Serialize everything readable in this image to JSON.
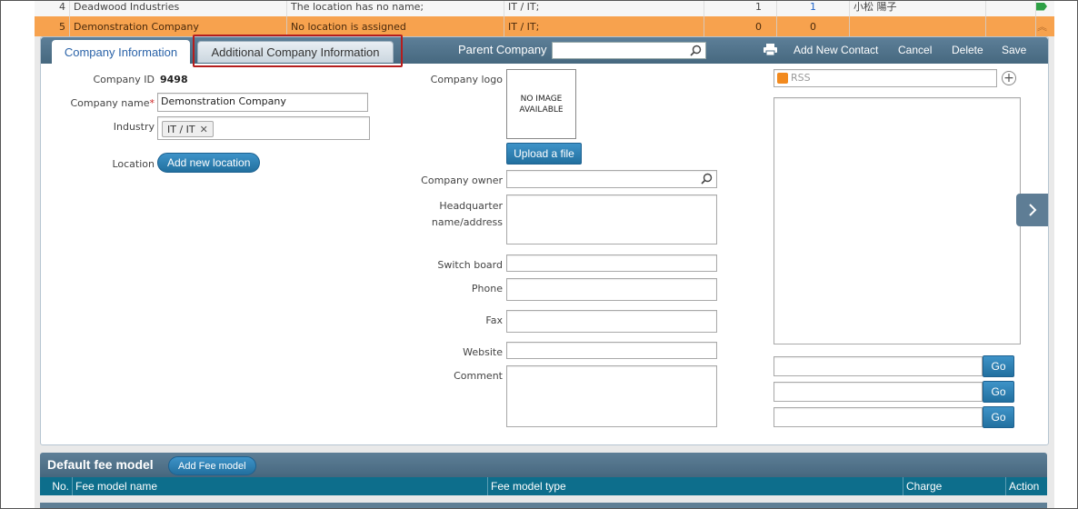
{
  "grid": {
    "rows": [
      {
        "num": "4",
        "name": "Deadwood Industries",
        "location": "The location has no name;",
        "industry": "IT / IT;",
        "c1": "1",
        "c2": "1",
        "contact": "小松 陽子"
      },
      {
        "num": "5",
        "name": "Demonstration Company",
        "location": "No location is assigned",
        "industry": "IT / IT;",
        "c1": "0",
        "c2": "0",
        "contact": ""
      }
    ]
  },
  "tabs": {
    "company_information": "Company Information",
    "additional_company_information": "Additional Company Information"
  },
  "toolbar": {
    "parent_company_label": "Parent Company",
    "parent_company_value": "",
    "add_new_contact": "Add New Contact",
    "cancel": "Cancel",
    "delete": "Delete",
    "save": "Save"
  },
  "form": {
    "company_id_label": "Company ID",
    "company_id_value": "9498",
    "company_name_label": "Company name",
    "required_mark": "*",
    "company_name_value": "Demonstration Company",
    "industry_label": "Industry",
    "industry_tag": "IT / IT",
    "tag_remove_glyph": "✕",
    "location_label": "Location",
    "add_new_location": "Add new location",
    "company_logo_label": "Company logo",
    "no_image_line1": "NO IMAGE",
    "no_image_line2": "AVAILABLE",
    "upload_file": "Upload a file",
    "company_owner_label": "Company owner",
    "company_owner_value": "",
    "headquarter_label_line1": "Headquarter",
    "headquarter_label_line2": "name/address",
    "headquarter_value": "",
    "switch_board_label": "Switch board",
    "switch_board_value": "",
    "phone_label": "Phone",
    "phone_value": "",
    "fax_label": "Fax",
    "fax_value": "",
    "website_label": "Website",
    "website_value": "",
    "comment_label": "Comment",
    "comment_value": ""
  },
  "right_panel": {
    "rss_placeholder": "RSS",
    "go_buttons": [
      "Go",
      "Go",
      "Go"
    ],
    "go_inputs": [
      "",
      "",
      ""
    ]
  },
  "fee_model": {
    "title": "Default fee model",
    "add_button": "Add Fee model",
    "columns": [
      "No.",
      "Fee model name",
      "Fee model type",
      "Charge",
      "Action"
    ]
  },
  "colors": {
    "selected_row": "#f7a24e",
    "toolbar": "#4f718a",
    "button": "#2a7fb3",
    "table_header": "#0d6e8c",
    "highlight_box": "#b51d1d"
  },
  "icons": [
    "search-icon",
    "print-icon",
    "remove-tag-icon",
    "rss-icon",
    "add-circle-icon",
    "chevron-right-icon",
    "chevron-up-icon",
    "status-arrows-icon"
  ]
}
